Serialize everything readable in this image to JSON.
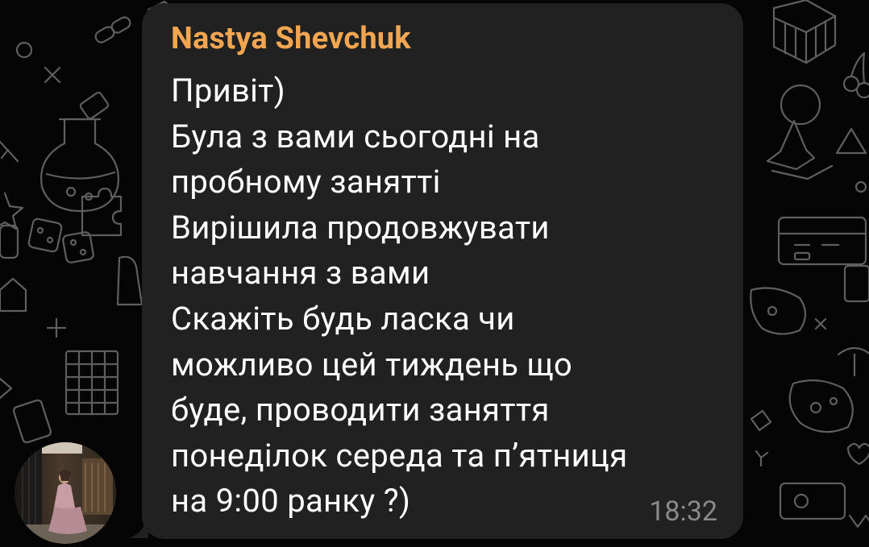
{
  "colors": {
    "background": "#050505",
    "bubble": "#212121",
    "sender_name": "#f2a652",
    "message_text": "#ffffff",
    "timestamp": "#8a8a8a",
    "doodle": "#5e5e5e"
  },
  "message": {
    "sender": "Nastya Shevchuk",
    "lines": [
      "Привіт)",
      "Була з вами сьогодні на",
      "пробному занятті",
      "Вирішила продовжувати",
      "навчання з вами",
      "Скажіть будь ласка чи",
      "можливо цей тиждень що",
      "буде, проводити заняття",
      "понеділок середа та п’ятниця",
      "на 9:00 ранку ?)"
    ],
    "time": "18:32"
  },
  "icons": {
    "avatar": "user-avatar-photo",
    "wallpaper": "game-doodle-pattern"
  }
}
